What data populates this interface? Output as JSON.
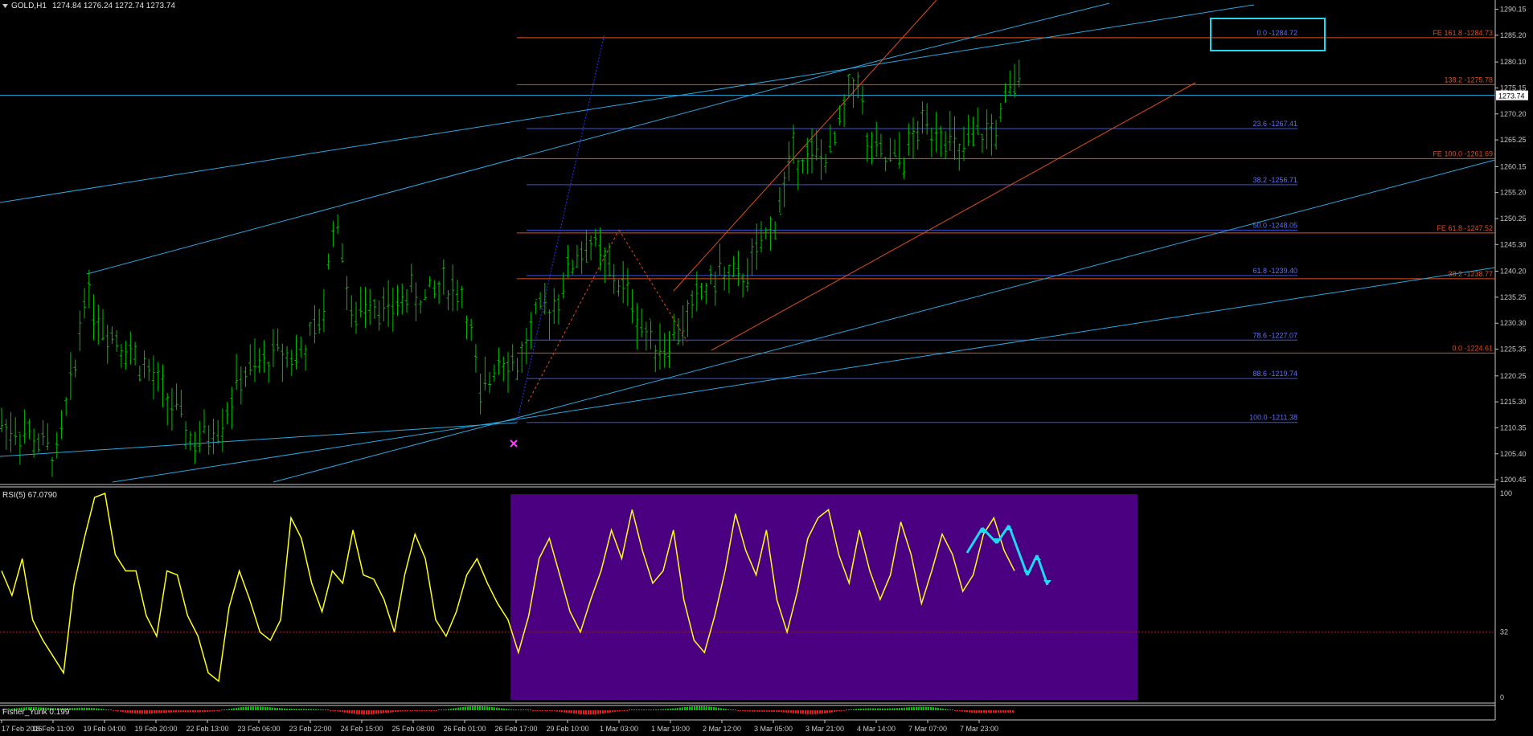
{
  "window": {
    "symbol_tf": "GOLD,H1",
    "ohlc": "1274.84 1276.24 1272.74 1273.74"
  },
  "colors": {
    "background": "#000000",
    "candle": "#00c000",
    "fib_blue": "#3a55d8",
    "fib_orange": "#e0501c",
    "trendline_cyan": "#29a8e0",
    "rsi_line": "#ffff1a",
    "rsi_highlight": "#4a0080",
    "annotation_cyan": "#20d8f0",
    "marker_magenta": "#ff40ff",
    "fisher_pos": "#00c000",
    "fisher_neg": "#e02020"
  },
  "chart_data": [
    {
      "type": "candlestick",
      "name": "GOLD,H1",
      "title": "GOLD,H1",
      "ylim": [
        1200.0,
        1291.0
      ],
      "y_ticks": [
        "1290.15",
        "1285.20",
        "1280.10",
        "1275.15",
        "1270.20",
        "1265.25",
        "1260.15",
        "1255.20",
        "1250.25",
        "1245.30",
        "1240.20",
        "1235.25",
        "1230.30",
        "1225.35",
        "1220.25",
        "1215.30",
        "1210.35",
        "1205.40",
        "1200.45"
      ],
      "current_price": "1273.74",
      "x_ticks": [
        "17 Feb 2016",
        "18 Feb 11:00",
        "19 Feb 04:00",
        "19 Feb 20:00",
        "22 Feb 13:00",
        "23 Feb 06:00",
        "23 Feb 22:00",
        "24 Feb 15:00",
        "25 Feb 08:00",
        "26 Feb 01:00",
        "26 Feb 17:00",
        "29 Feb 10:00",
        "1 Mar 03:00",
        "1 Mar 19:00",
        "2 Mar 12:00",
        "3 Mar 05:00",
        "3 Mar 21:00",
        "4 Mar 14:00",
        "7 Mar 07:00",
        "7 Mar 23:00"
      ],
      "price_path": [
        [
          0,
          1211
        ],
        [
          3,
          1209
        ],
        [
          6,
          1205
        ],
        [
          8,
          1222
        ],
        [
          9,
          1237
        ],
        [
          11,
          1230
        ],
        [
          13,
          1227
        ],
        [
          15,
          1223
        ],
        [
          18,
          1216
        ],
        [
          21,
          1207
        ],
        [
          24,
          1212
        ],
        [
          26,
          1220
        ],
        [
          28,
          1222
        ],
        [
          30,
          1225
        ],
        [
          32,
          1224
        ],
        [
          34,
          1228
        ],
        [
          35,
          1233
        ],
        [
          36,
          1250
        ],
        [
          37,
          1245
        ],
        [
          38,
          1230
        ],
        [
          40,
          1236
        ],
        [
          42,
          1232
        ],
        [
          44,
          1236
        ],
        [
          46,
          1235
        ],
        [
          48,
          1238
        ],
        [
          50,
          1236
        ],
        [
          51,
          1228
        ],
        [
          52,
          1215
        ],
        [
          54,
          1225
        ],
        [
          56,
          1222
        ],
        [
          58,
          1231
        ],
        [
          60,
          1234
        ],
        [
          62,
          1242
        ],
        [
          64,
          1246
        ],
        [
          66,
          1240
        ],
        [
          68,
          1236
        ],
        [
          70,
          1228
        ],
        [
          72,
          1226
        ],
        [
          74,
          1230
        ],
        [
          76,
          1236
        ],
        [
          78,
          1240
        ],
        [
          80,
          1238
        ],
        [
          82,
          1243
        ],
        [
          84,
          1250
        ],
        [
          86,
          1263
        ],
        [
          88,
          1262
        ],
        [
          90,
          1262
        ],
        [
          92,
          1274
        ],
        [
          93,
          1278
        ],
        [
          94,
          1264
        ],
        [
          96,
          1261
        ],
        [
          98,
          1262
        ],
        [
          100,
          1268
        ],
        [
          102,
          1268
        ],
        [
          104,
          1262
        ],
        [
          106,
          1266
        ],
        [
          108,
          1267
        ],
        [
          110,
          1276
        ]
      ],
      "fib_retracement": [
        {
          "level": "0.0",
          "price": "1284.72"
        },
        {
          "level": "23.6",
          "price": "1267.41"
        },
        {
          "level": "38.2",
          "price": "1256.71"
        },
        {
          "level": "50.0",
          "price": "1248.05"
        },
        {
          "level": "61.8",
          "price": "1239.40"
        },
        {
          "level": "78.6",
          "price": "1227.07"
        },
        {
          "level": "88.6",
          "price": "1219.74"
        },
        {
          "level": "100.0",
          "price": "1211.38"
        }
      ],
      "fib_expansion": [
        {
          "label": "FE 161.8",
          "price": "1284.73"
        },
        {
          "label": "138.2",
          "price": "1275.78"
        },
        {
          "label": "FE 100.0",
          "price": "1261.69"
        },
        {
          "label": "FE 61.8",
          "price": "1247.52"
        },
        {
          "label": "38.2",
          "price": "1238.77"
        },
        {
          "label": "0.0",
          "price": "1224.61"
        }
      ]
    },
    {
      "type": "line",
      "name": "RSI(5)",
      "title": "RSI(5) 67.0790",
      "ylim": [
        0,
        100
      ],
      "y_ticks": [
        "100",
        "32",
        "0"
      ],
      "level": 32,
      "values": [
        62,
        50,
        68,
        38,
        28,
        20,
        12,
        55,
        78,
        98,
        100,
        70,
        62,
        62,
        40,
        30,
        62,
        60,
        40,
        30,
        12,
        8,
        44,
        62,
        48,
        32,
        28,
        38,
        88,
        78,
        56,
        42,
        62,
        56,
        82,
        60,
        58,
        48,
        32,
        60,
        80,
        68,
        38,
        30,
        42,
        60,
        68,
        56,
        46,
        38,
        22,
        40,
        68,
        78,
        60,
        42,
        32,
        48,
        62,
        82,
        68,
        92,
        72,
        56,
        62,
        82,
        48,
        28,
        22,
        40,
        62,
        90,
        72,
        60,
        82,
        48,
        32,
        52,
        78,
        88,
        92,
        70,
        56,
        82,
        62,
        48,
        60,
        86,
        70,
        46,
        62,
        80,
        70,
        52,
        60,
        80,
        88,
        72,
        62
      ]
    },
    {
      "type": "bar",
      "name": "Fisher_Yurik",
      "title": "Fisher_Yurik 0.199"
    }
  ]
}
